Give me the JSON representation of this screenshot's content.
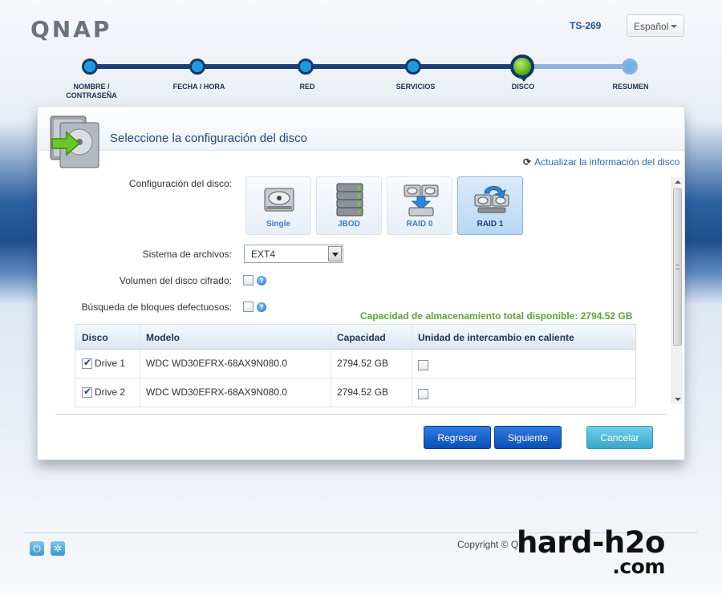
{
  "header": {
    "logo": "QNAP",
    "model": "TS-269",
    "language": "Español"
  },
  "wizard": {
    "steps": [
      {
        "label": "NOMBRE / CONTRASEÑA",
        "state": "done"
      },
      {
        "label": "FECHA / HORA",
        "state": "done"
      },
      {
        "label": "RED",
        "state": "done"
      },
      {
        "label": "SERVICIOS",
        "state": "done"
      },
      {
        "label": "DISCO",
        "state": "current"
      },
      {
        "label": "RESUMEN",
        "state": "pending"
      }
    ]
  },
  "panel": {
    "title": "Seleccione la configuración del disco",
    "refresh_label": "Actualizar la información del disco",
    "disk_config_label": "Configuración del disco:",
    "disk_options": [
      {
        "label": "Single",
        "icon": "single-disk-icon",
        "selected": false
      },
      {
        "label": "JBOD",
        "icon": "jbod-icon",
        "selected": false
      },
      {
        "label": "RAID 0",
        "icon": "raid0-icon",
        "selected": false
      },
      {
        "label": "RAID 1",
        "icon": "raid1-icon",
        "selected": true
      }
    ],
    "filesystem_label": "Sistema de archivos:",
    "filesystem_value": "EXT4",
    "encrypted_label": "Volumen del disco cifrado:",
    "encrypted_checked": false,
    "badblock_label": "Búsqueda de bloques defectuosos:",
    "badblock_checked": false,
    "capacity_text": "Capacidad de almacenamiento total disponible: 2794.52 GB",
    "table": {
      "columns": [
        "Disco",
        "Modelo",
        "Capacidad",
        "Unidad de intercambio en caliente"
      ],
      "rows": [
        {
          "disk": "Drive 1",
          "checked": true,
          "model": "WDC WD30EFRX-68AX9N080.0",
          "capacity": "2794.52 GB",
          "hot_spare": false
        },
        {
          "disk": "Drive 2",
          "checked": true,
          "model": "WDC WD30EFRX-68AX9N080.0",
          "capacity": "2794.52 GB",
          "hot_spare": false
        }
      ]
    },
    "buttons": {
      "back": "Regresar",
      "next": "Siguiente",
      "cancel": "Cancelar"
    }
  },
  "footer": {
    "copyright": "Copyright © Q",
    "watermark_line1": "hard-h2o",
    "watermark_line2": ".com"
  },
  "colors": {
    "accent_blue": "#0d4fb4",
    "step_done": "#1e9be0",
    "step_current": "#5db21e",
    "capacity_green": "#5aa63a"
  }
}
